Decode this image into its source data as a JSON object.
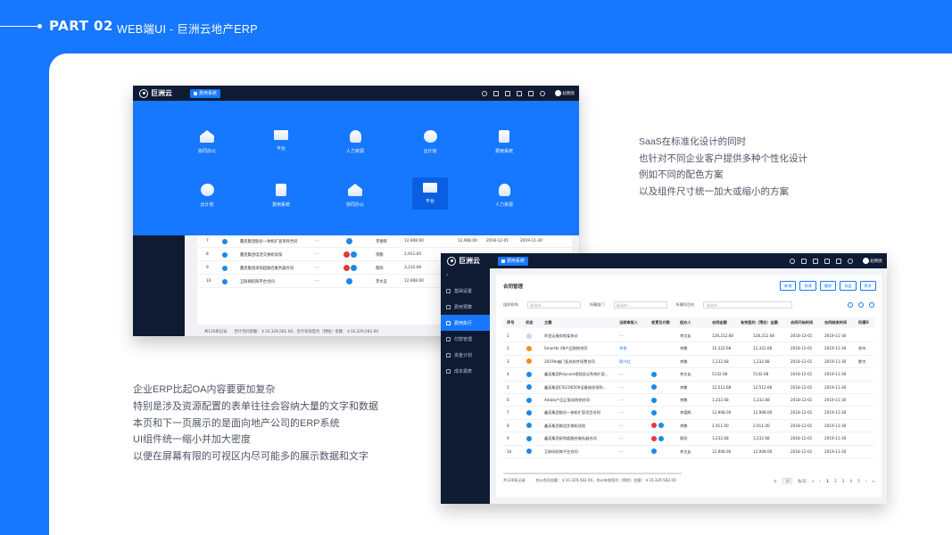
{
  "header": {
    "part": "PART 02",
    "title": "WEB端UI - 巨洲云地产ERP"
  },
  "notes": {
    "right": [
      "SaaS在标准化设计的同时",
      "也针对不同企业客户提供多种个性化设计",
      "例如不同的配色方案",
      "以及组件尺寸统一加大或缩小的方案"
    ],
    "left": [
      "企业ERP比起OA内容要更加复杂",
      "特别是涉及资源配置的表单往往会容纳大量的文字和数据",
      "本页和下一页展示的是面向地产公司的ERP系统",
      "UI组件统一缩小并加大密度",
      "以便在屏幕有限的可视区内尽可能多的展示数据和文字"
    ]
  },
  "app": {
    "logo": "巨洲云",
    "chip": "费用系统",
    "user": "赵明亮"
  },
  "menu": [
    {
      "label": "协同办公",
      "icon": "house-icon"
    },
    {
      "label": "平台",
      "icon": "screen-icon"
    },
    {
      "label": "人力资源",
      "icon": "person-icon"
    },
    {
      "label": "云计划",
      "icon": "cloud-icon"
    },
    {
      "label": "费用系统",
      "icon": "doc-icon"
    },
    {
      "label": "云计划",
      "icon": "cloud-icon"
    },
    {
      "label": "费用系统",
      "icon": "doc-icon"
    },
    {
      "label": "协同办公",
      "icon": "house-icon"
    },
    {
      "label": "平台",
      "icon": "screen-icon",
      "active": true
    },
    {
      "label": "人力资源",
      "icon": "person-icon"
    }
  ],
  "win1": {
    "rows": [
      {
        "no": "7",
        "title": "鑫苑集团股份一体机扩容项目合同",
        "dash": "- -",
        "owner": "李德辉",
        "amt": "12,908.00",
        "amt2": "12,908.00",
        "start": "2018-12-01",
        "end": "2019-11-30"
      },
      {
        "no": "8",
        "title": "鑫苑集团电话交换机续保",
        "dash": "- -",
        "owner": "李鹏",
        "amt": "2,911.00"
      },
      {
        "no": "9",
        "title": "鑫苑集团采购超融合服务器合同",
        "dash": "- -",
        "owner": "蔡阳",
        "amt": "3,232.68"
      },
      {
        "no": "10",
        "title": "互联网招商平台合同",
        "dash": "- -",
        "owner": "李文友",
        "amt": "12,908.00"
      }
    ],
    "foot_total": "共126条记录",
    "foot_sum": "合计合同金额：￥10,329,582.00，合计有效签约（预估）金额：￥10,329,582.00"
  },
  "win2": {
    "side": [
      "基础设置",
      "费用预算",
      "费用执行",
      "付款管理",
      "资金计划",
      "成本报表"
    ],
    "crumb": "合同管理",
    "buttons": [
      "新增",
      "修改",
      "删除",
      "导出",
      "更多"
    ],
    "filters": [
      {
        "label": "组织机构",
        "ph": "请选择..."
      },
      {
        "label": "所属部门",
        "ph": "请选择..."
      },
      {
        "label": "所属项目名",
        "ph": "请选择..."
      }
    ],
    "head": [
      "序号",
      "状态",
      "主题",
      "当前审批人",
      "变更及付款",
      "经办人",
      "合同金额",
      "有效签约（预估）金额",
      "合同开始时间",
      "合同结束时间",
      "所属D"
    ],
    "rows": [
      {
        "no": "1",
        "st": "gray",
        "title": "阿里云服务框架协议",
        "appr": "- -",
        "tags": "",
        "man": "李文友",
        "amt": "128,212.68",
        "amt2": "128,212.68",
        "s": "2018-12-01",
        "e": "2019-11-30",
        "d": ""
      },
      {
        "no": "2",
        "st": "orange",
        "title": "Smartbi V8产品购销合同",
        "appr": "李艳",
        "tags": "",
        "man": "李鹏",
        "amt": "12,322.68",
        "amt2": "12,322.68",
        "s": "2018-12-01",
        "e": "2019-11-30",
        "d": "郑州"
      },
      {
        "no": "3",
        "st": "orange",
        "title": "2019年幽门拓充软件续费合同",
        "appr": "周兴红",
        "tags": "",
        "man": "李鹏",
        "amt": "1,232.68",
        "amt2": "1,232.68",
        "s": "2018-12-01",
        "e": "2019-11-30",
        "d": "数字"
      },
      {
        "no": "4",
        "st": "blue",
        "title": "鑫苑集团Polycom视频会议系统扩容...",
        "appr": "- -",
        "tags": "b",
        "man": "李文友",
        "amt": "5142.68",
        "amt2": "5142.68",
        "s": "2018-12-01",
        "e": "2019-11-30",
        "d": ""
      },
      {
        "no": "5",
        "st": "blue",
        "title": "鑫苑集团CISCO6509设备维保采购...",
        "appr": "- -",
        "tags": "b",
        "man": "李鹏",
        "amt": "12,512.68",
        "amt2": "12,512.68",
        "s": "2018-12-01",
        "e": "2019-11-30",
        "d": ""
      },
      {
        "no": "6",
        "st": "blue",
        "title": "Adobe产品正版化购销合同",
        "appr": "- -",
        "tags": "b",
        "man": "李鹏",
        "amt": "1,232.68",
        "amt2": "1,232.68",
        "s": "2018-12-01",
        "e": "2019-11-30",
        "d": ""
      },
      {
        "no": "7",
        "st": "blue",
        "title": "鑫苑集团股份一体机扩容项目合同",
        "appr": "- -",
        "tags": "b",
        "man": "李德辉",
        "amt": "12,908.00",
        "amt2": "12,908.00",
        "s": "2018-12-01",
        "e": "2019-11-30",
        "d": ""
      },
      {
        "no": "8",
        "st": "blue",
        "title": "鑫苑集团电话交换机续保",
        "appr": "- -",
        "tags": "rb",
        "man": "李鹏",
        "amt": "2,911.00",
        "amt2": "2,911.00",
        "s": "2018-12-01",
        "e": "2019-11-30",
        "d": ""
      },
      {
        "no": "9",
        "st": "blue",
        "title": "鑫苑集团采购超融合服务器合同",
        "appr": "- -",
        "tags": "rb",
        "man": "蔡阳",
        "amt": "3,232.68",
        "amt2": "3,232.68",
        "s": "2018-12-01",
        "e": "2019-11-30",
        "d": ""
      },
      {
        "no": "10",
        "st": "blue",
        "title": "互联网招商平台合同",
        "appr": "- -",
        "tags": "b",
        "man": "李文友",
        "amt": "12,908.00",
        "amt2": "12,908.00",
        "s": "2018-12-01",
        "e": "2019-11-30",
        "d": ""
      }
    ],
    "foot_total": "共126条记录",
    "foot_sum": "合计合同金额：￥10,329,582.00，合计有效签约（预估）金额：￥10,329,582.00",
    "page_size": "10",
    "page_unit": "条/页",
    "pages": [
      "1",
      "2",
      "3",
      "4",
      "5"
    ]
  }
}
